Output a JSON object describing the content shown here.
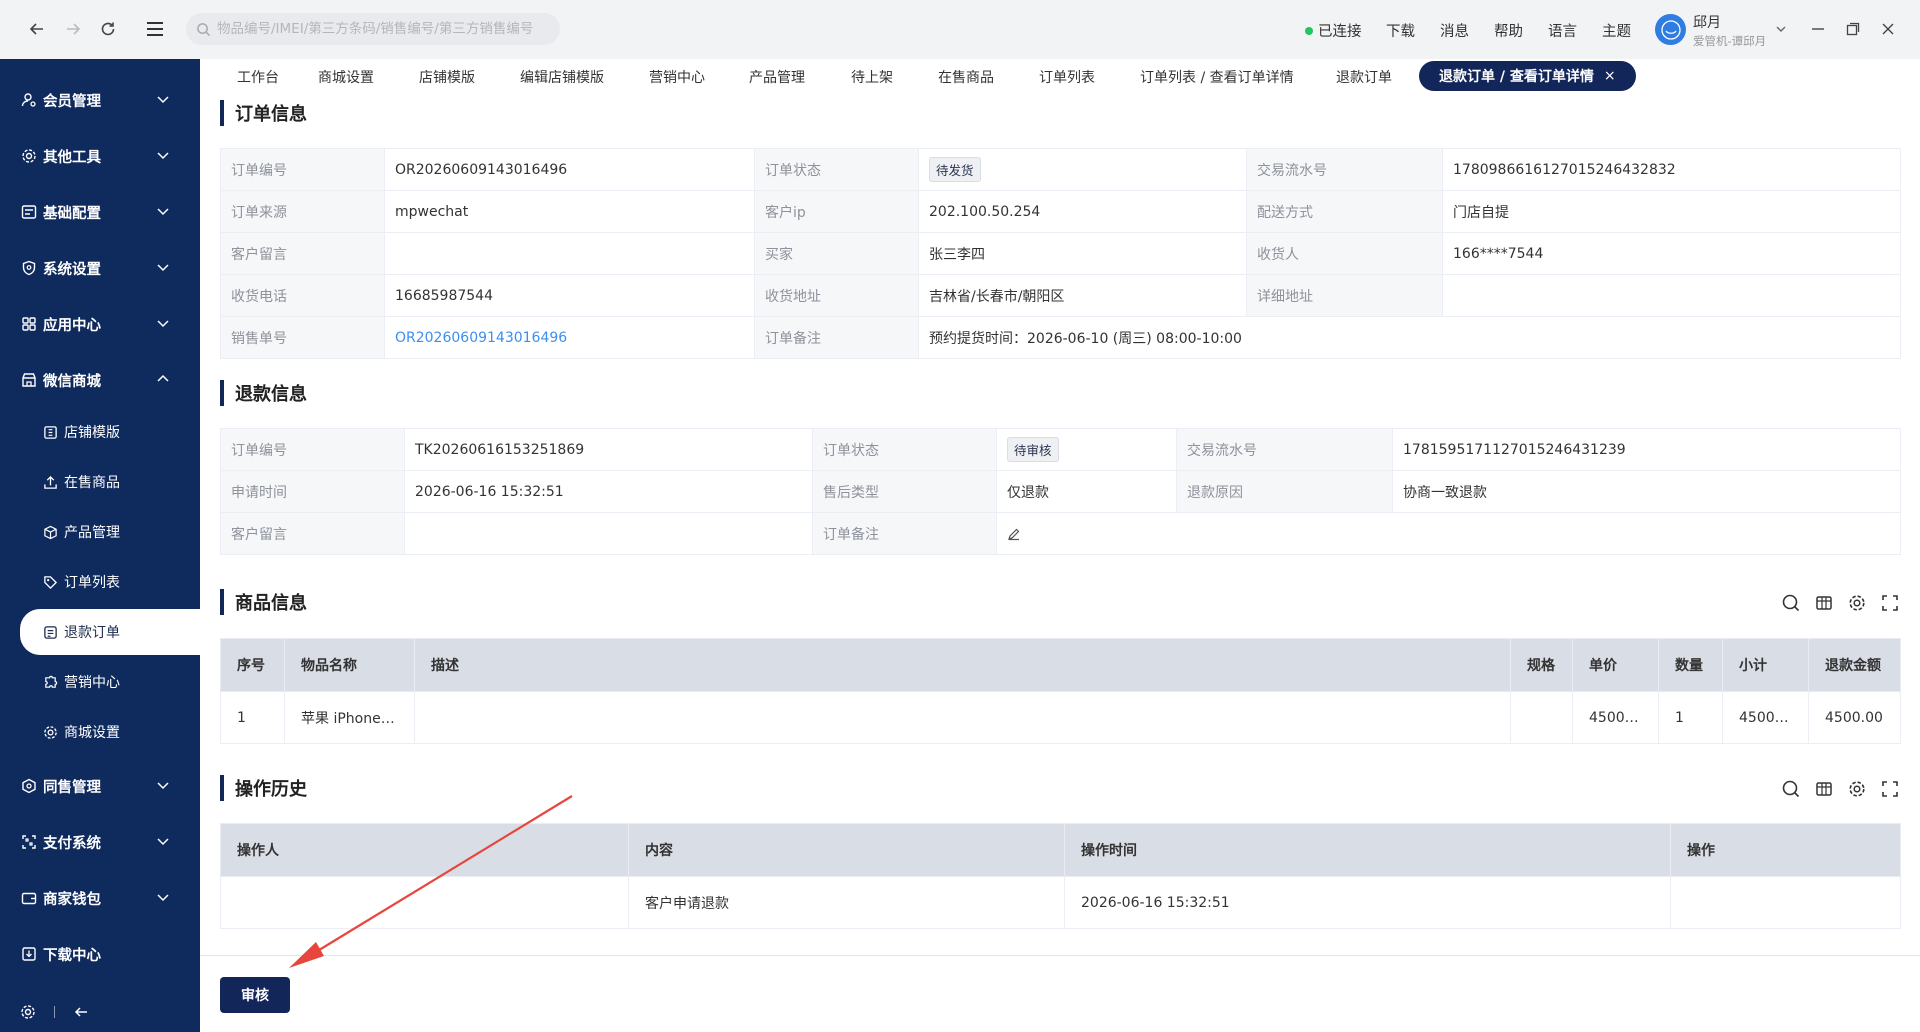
{
  "topbar": {
    "search_placeholder": "物品编号/IMEI/第三方条码/销售编号/第三方销售编号",
    "status": "已连接",
    "menu": [
      "下载",
      "消息",
      "帮助",
      "语言",
      "主题"
    ],
    "user_name": "邱月",
    "user_role": "爱管机-谭邱月",
    "status_color": "#22c55e"
  },
  "sidebar": {
    "groups": [
      {
        "label": "会员管理",
        "icon": "user-gear-icon"
      },
      {
        "label": "其他工具",
        "icon": "gear-icon"
      },
      {
        "label": "基础配置",
        "icon": "list-icon"
      },
      {
        "label": "系统设置",
        "icon": "shield-icon"
      },
      {
        "label": "应用中心",
        "icon": "apps-icon"
      },
      {
        "label": "微信商城",
        "icon": "shop-icon"
      },
      {
        "label": "同售管理",
        "icon": "hexagon-icon"
      },
      {
        "label": "支付系统",
        "icon": "scan-icon"
      },
      {
        "label": "商家钱包",
        "icon": "wallet-icon"
      },
      {
        "label": "下载中心",
        "icon": "download-icon"
      }
    ],
    "sub_items": [
      {
        "label": "店铺模版",
        "icon": "template-icon"
      },
      {
        "label": "在售商品",
        "icon": "upload-icon"
      },
      {
        "label": "产品管理",
        "icon": "box-icon"
      },
      {
        "label": "订单列表",
        "icon": "tag-icon"
      },
      {
        "label": "退款订单",
        "icon": "refund-icon"
      },
      {
        "label": "营销中心",
        "icon": "puzzle-icon"
      },
      {
        "label": "商城设置",
        "icon": "gear-icon"
      }
    ],
    "active": "退款订单",
    "bg_color": "#0f2a5c"
  },
  "tabs": {
    "items": [
      "工作台",
      "商城设置",
      "店铺模版",
      "编辑店铺模版",
      "营销中心",
      "产品管理",
      "待上架",
      "在售商品",
      "订单列表",
      "订单列表 / 查看订单详情",
      "退款订单"
    ],
    "active": "退款订单 / 查看订单详情",
    "active_color": "#13265a"
  },
  "order_info": {
    "title": "订单信息",
    "labels": {
      "order_no": "订单编号",
      "status": "订单状态",
      "trade_no": "交易流水号",
      "source": "订单来源",
      "client_ip": "客户ip",
      "delivery": "配送方式",
      "remark": "客户留言",
      "buyer": "买家",
      "receiver": "收货人",
      "phone": "收货电话",
      "address": "收货地址",
      "address_detail": "详细地址",
      "sale_no": "销售单号",
      "order_note": "订单备注"
    },
    "values": {
      "order_no": "OR20260609143016496",
      "status": "待发货",
      "trade_no": "17809866161270152464328​32",
      "source": "mpwechat",
      "client_ip": "202.100.50.254",
      "delivery": "门店自提",
      "remark": "",
      "buyer": "张三李四",
      "receiver": "166****7544",
      "phone": "16685987544",
      "address": "吉林省/长春市/朝阳区",
      "address_detail": "",
      "sale_no": "OR20260609143016496",
      "order_note": "预约提货时间：2026-06-10 (周三) 08:00-10:00"
    }
  },
  "refund_info": {
    "title": "退款信息",
    "labels": {
      "order_no": "订单编号",
      "status": "订单状态",
      "trade_no": "交易流水号",
      "apply_time": "申请时间",
      "type": "售后类型",
      "reason": "退款原因",
      "remark": "客户留言",
      "note": "订单备注"
    },
    "values": {
      "order_no": "TK20260616153251869",
      "status": "待审核",
      "trade_no": "1781595171127015246431239",
      "apply_time": "2026-06-16 15:32:51",
      "type": "仅退款",
      "reason": "协商一致退款",
      "remark": ""
    }
  },
  "goods": {
    "title": "商品信息",
    "columns": [
      "序号",
      "物品名称",
      "描述",
      "规格",
      "单价",
      "数量",
      "小计",
      "退款金额"
    ],
    "rows": [
      [
        "1",
        "苹果 iPhone ...",
        "",
        "",
        "4500.00",
        "1",
        "4500.00",
        "4500.00"
      ]
    ]
  },
  "history": {
    "title": "操作历史",
    "columns": [
      "操作人",
      "内容",
      "操作时间",
      "操作"
    ],
    "rows": [
      [
        "",
        "客户申请退款",
        "2026-06-16 15:32:51",
        ""
      ]
    ]
  },
  "footer": {
    "audit_label": "审核"
  },
  "annotation": {
    "arrow_color": "#e8453c"
  }
}
